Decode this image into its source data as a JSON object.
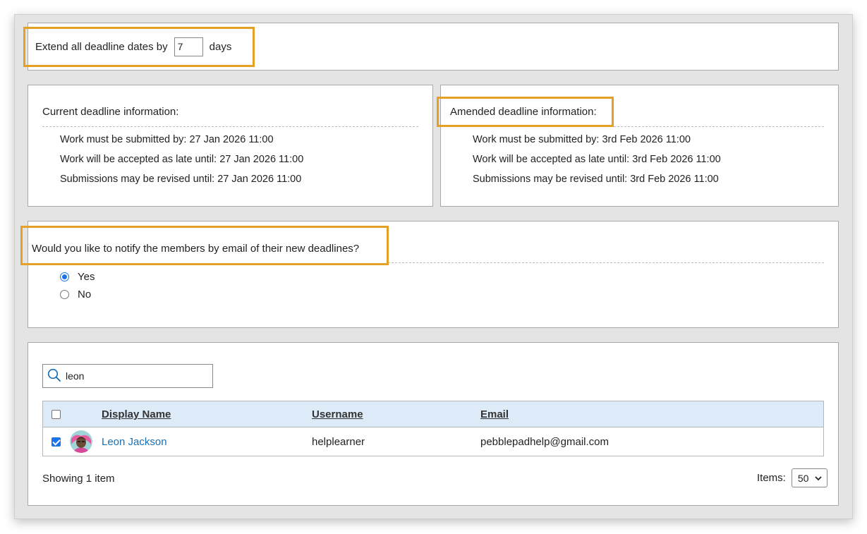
{
  "extend": {
    "label_before": "Extend all deadline dates by",
    "days_value": "7",
    "label_after": "days"
  },
  "current": {
    "title": "Current deadline information:",
    "lines": [
      "Work must be submitted by: 27 Jan 2026 11:00",
      "Work will be accepted as late until: 27 Jan 2026 11:00",
      "Submissions may be revised until: 27 Jan 2026 11:00"
    ]
  },
  "amended": {
    "title": "Amended deadline information:",
    "lines": [
      "Work must be submitted by: 3rd Feb 2026 11:00",
      "Work will be accepted as late until: 3rd Feb 2026 11:00",
      "Submissions may be revised until: 3rd Feb 2026 11:00"
    ]
  },
  "notify": {
    "question": "Would you like to notify the members by email of their new deadlines?",
    "options": [
      "Yes",
      "No"
    ],
    "selected": "Yes"
  },
  "search": {
    "value": "leon",
    "icon": "search-icon"
  },
  "table": {
    "headers": {
      "display_name": "Display Name",
      "username": "Username",
      "email": "Email"
    },
    "rows": [
      {
        "checked": true,
        "display_name": "Leon Jackson",
        "username": "helplearner",
        "email": "pebblepadhelp@gmail.com"
      }
    ]
  },
  "footer": {
    "showing": "Showing 1 item",
    "items_label": "Items:",
    "items_value": "50"
  },
  "colors": {
    "highlight": "#e5a126",
    "header_bg": "#ddebf9",
    "link": "#1a6fb5",
    "accent": "#1a73e8"
  }
}
